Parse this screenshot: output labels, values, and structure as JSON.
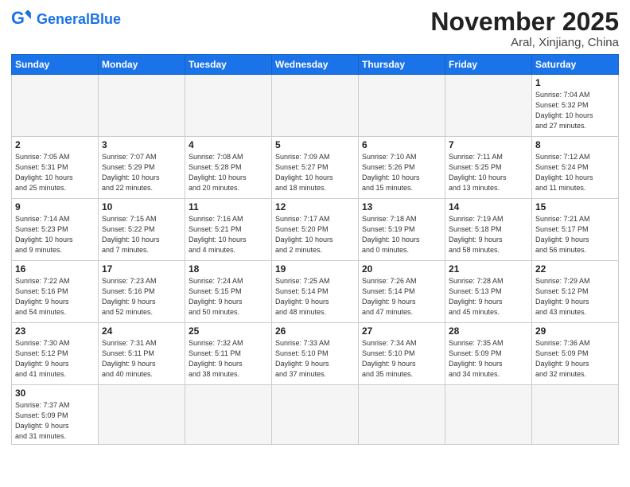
{
  "header": {
    "logo_general": "General",
    "logo_blue": "Blue",
    "month_title": "November 2025",
    "location": "Aral, Xinjiang, China"
  },
  "weekdays": [
    "Sunday",
    "Monday",
    "Tuesday",
    "Wednesday",
    "Thursday",
    "Friday",
    "Saturday"
  ],
  "weeks": [
    [
      {
        "day": "",
        "info": ""
      },
      {
        "day": "",
        "info": ""
      },
      {
        "day": "",
        "info": ""
      },
      {
        "day": "",
        "info": ""
      },
      {
        "day": "",
        "info": ""
      },
      {
        "day": "",
        "info": ""
      },
      {
        "day": "1",
        "info": "Sunrise: 7:04 AM\nSunset: 5:32 PM\nDaylight: 10 hours\nand 27 minutes."
      }
    ],
    [
      {
        "day": "2",
        "info": "Sunrise: 7:05 AM\nSunset: 5:31 PM\nDaylight: 10 hours\nand 25 minutes."
      },
      {
        "day": "3",
        "info": "Sunrise: 7:07 AM\nSunset: 5:29 PM\nDaylight: 10 hours\nand 22 minutes."
      },
      {
        "day": "4",
        "info": "Sunrise: 7:08 AM\nSunset: 5:28 PM\nDaylight: 10 hours\nand 20 minutes."
      },
      {
        "day": "5",
        "info": "Sunrise: 7:09 AM\nSunset: 5:27 PM\nDaylight: 10 hours\nand 18 minutes."
      },
      {
        "day": "6",
        "info": "Sunrise: 7:10 AM\nSunset: 5:26 PM\nDaylight: 10 hours\nand 15 minutes."
      },
      {
        "day": "7",
        "info": "Sunrise: 7:11 AM\nSunset: 5:25 PM\nDaylight: 10 hours\nand 13 minutes."
      },
      {
        "day": "8",
        "info": "Sunrise: 7:12 AM\nSunset: 5:24 PM\nDaylight: 10 hours\nand 11 minutes."
      }
    ],
    [
      {
        "day": "9",
        "info": "Sunrise: 7:14 AM\nSunset: 5:23 PM\nDaylight: 10 hours\nand 9 minutes."
      },
      {
        "day": "10",
        "info": "Sunrise: 7:15 AM\nSunset: 5:22 PM\nDaylight: 10 hours\nand 7 minutes."
      },
      {
        "day": "11",
        "info": "Sunrise: 7:16 AM\nSunset: 5:21 PM\nDaylight: 10 hours\nand 4 minutes."
      },
      {
        "day": "12",
        "info": "Sunrise: 7:17 AM\nSunset: 5:20 PM\nDaylight: 10 hours\nand 2 minutes."
      },
      {
        "day": "13",
        "info": "Sunrise: 7:18 AM\nSunset: 5:19 PM\nDaylight: 10 hours\nand 0 minutes."
      },
      {
        "day": "14",
        "info": "Sunrise: 7:19 AM\nSunset: 5:18 PM\nDaylight: 9 hours\nand 58 minutes."
      },
      {
        "day": "15",
        "info": "Sunrise: 7:21 AM\nSunset: 5:17 PM\nDaylight: 9 hours\nand 56 minutes."
      }
    ],
    [
      {
        "day": "16",
        "info": "Sunrise: 7:22 AM\nSunset: 5:16 PM\nDaylight: 9 hours\nand 54 minutes."
      },
      {
        "day": "17",
        "info": "Sunrise: 7:23 AM\nSunset: 5:16 PM\nDaylight: 9 hours\nand 52 minutes."
      },
      {
        "day": "18",
        "info": "Sunrise: 7:24 AM\nSunset: 5:15 PM\nDaylight: 9 hours\nand 50 minutes."
      },
      {
        "day": "19",
        "info": "Sunrise: 7:25 AM\nSunset: 5:14 PM\nDaylight: 9 hours\nand 48 minutes."
      },
      {
        "day": "20",
        "info": "Sunrise: 7:26 AM\nSunset: 5:14 PM\nDaylight: 9 hours\nand 47 minutes."
      },
      {
        "day": "21",
        "info": "Sunrise: 7:28 AM\nSunset: 5:13 PM\nDaylight: 9 hours\nand 45 minutes."
      },
      {
        "day": "22",
        "info": "Sunrise: 7:29 AM\nSunset: 5:12 PM\nDaylight: 9 hours\nand 43 minutes."
      }
    ],
    [
      {
        "day": "23",
        "info": "Sunrise: 7:30 AM\nSunset: 5:12 PM\nDaylight: 9 hours\nand 41 minutes."
      },
      {
        "day": "24",
        "info": "Sunrise: 7:31 AM\nSunset: 5:11 PM\nDaylight: 9 hours\nand 40 minutes."
      },
      {
        "day": "25",
        "info": "Sunrise: 7:32 AM\nSunset: 5:11 PM\nDaylight: 9 hours\nand 38 minutes."
      },
      {
        "day": "26",
        "info": "Sunrise: 7:33 AM\nSunset: 5:10 PM\nDaylight: 9 hours\nand 37 minutes."
      },
      {
        "day": "27",
        "info": "Sunrise: 7:34 AM\nSunset: 5:10 PM\nDaylight: 9 hours\nand 35 minutes."
      },
      {
        "day": "28",
        "info": "Sunrise: 7:35 AM\nSunset: 5:09 PM\nDaylight: 9 hours\nand 34 minutes."
      },
      {
        "day": "29",
        "info": "Sunrise: 7:36 AM\nSunset: 5:09 PM\nDaylight: 9 hours\nand 32 minutes."
      }
    ],
    [
      {
        "day": "30",
        "info": "Sunrise: 7:37 AM\nSunset: 5:09 PM\nDaylight: 9 hours\nand 31 minutes."
      },
      {
        "day": "",
        "info": ""
      },
      {
        "day": "",
        "info": ""
      },
      {
        "day": "",
        "info": ""
      },
      {
        "day": "",
        "info": ""
      },
      {
        "day": "",
        "info": ""
      },
      {
        "day": "",
        "info": ""
      }
    ]
  ]
}
